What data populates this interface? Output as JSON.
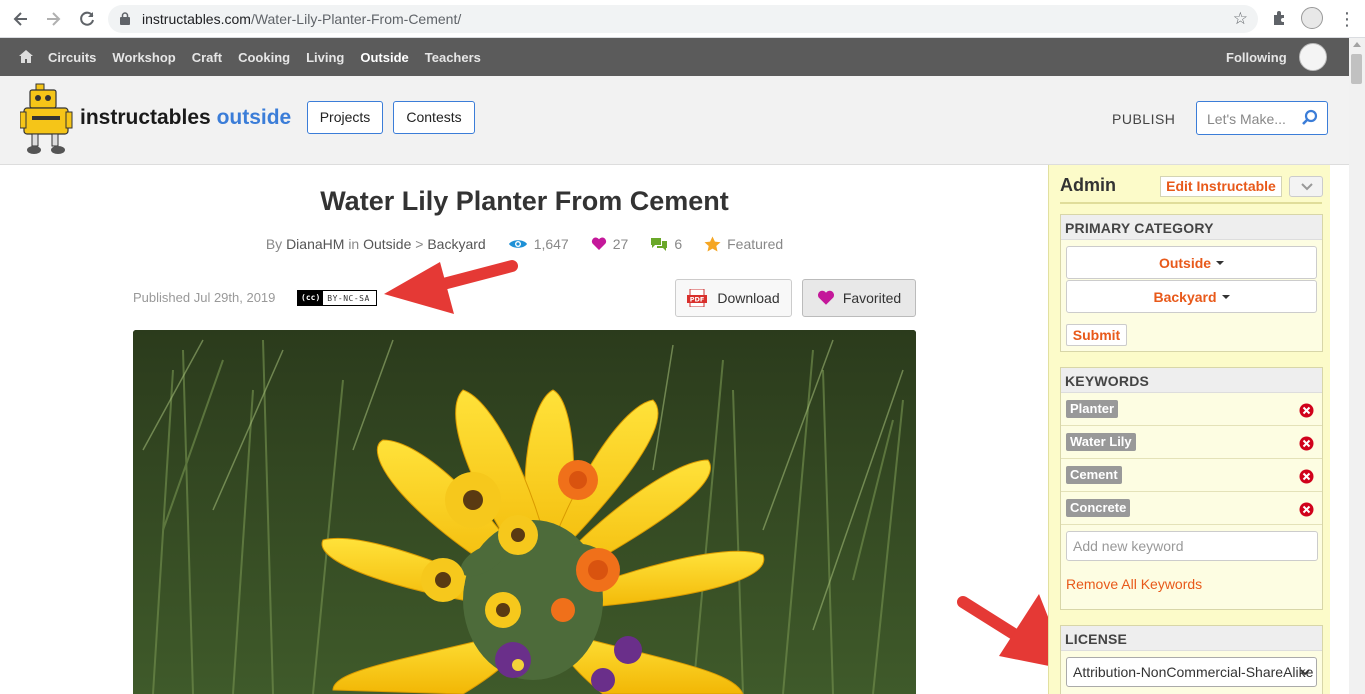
{
  "browser": {
    "url_domain": "instructables.com",
    "url_path": "/Water-Lily-Planter-From-Cement/"
  },
  "topnav": {
    "categories": [
      "Circuits",
      "Workshop",
      "Craft",
      "Cooking",
      "Living",
      "Outside",
      "Teachers"
    ],
    "active": "Outside",
    "following_label": "Following"
  },
  "header": {
    "brand_main": "instructables",
    "brand_sub": "outside",
    "projects_label": "Projects",
    "contests_label": "Contests",
    "publish_label": "PUBLISH",
    "search_placeholder": "Let's Make..."
  },
  "article": {
    "title": "Water Lily Planter From Cement",
    "by_prefix": "By",
    "author": "DianaHM",
    "in_word": "in",
    "category": "Outside",
    "separator": ">",
    "subcategory": "Backyard",
    "views": "1,647",
    "favorites": "27",
    "comments": "6",
    "featured_label": "Featured",
    "published": "Published Jul 29th, 2019",
    "license_badge_cc": "(cc)",
    "license_badge_text": "BY-NC-SA",
    "download_label": "Download",
    "favorited_label": "Favorited"
  },
  "admin": {
    "heading": "Admin",
    "edit_label": "Edit Instructable",
    "primary_category_heading": "PRIMARY CATEGORY",
    "category": "Outside",
    "subcategory": "Backyard",
    "submit_label": "Submit",
    "keywords_heading": "KEYWORDS",
    "keywords": [
      "Planter",
      "Water Lily",
      "Cement",
      "Concrete"
    ],
    "add_keyword_placeholder": "Add new keyword",
    "remove_all_label": "Remove All Keywords",
    "license_heading": "LICENSE",
    "license_value": "Attribution-NonCommercial-ShareAlike"
  },
  "colors": {
    "accent_blue": "#3b7dd8",
    "accent_orange": "#e8591a",
    "admin_bg": "#fcfbc9",
    "nav_bg": "#5b5b5b",
    "annotation_red": "#e53935"
  }
}
